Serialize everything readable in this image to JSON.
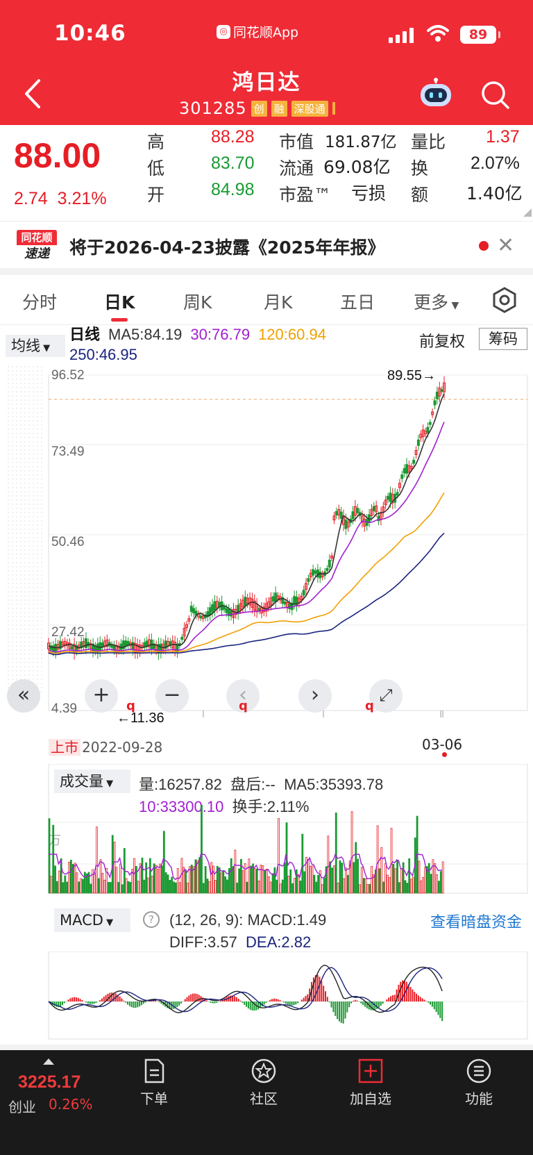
{
  "status": {
    "time": "10:46",
    "app": "同花顺App",
    "battery": "89"
  },
  "header": {
    "name": "鸿日达",
    "code": "301285",
    "tags": [
      "创",
      "融",
      "深股通"
    ]
  },
  "quote": {
    "price": "88.00",
    "change": "2.74",
    "pct": "3.21%",
    "high_label": "高",
    "high": "88.28",
    "low_label": "低",
    "low": "83.70",
    "open_label": "开",
    "open": "84.98",
    "mcap_label": "市值",
    "mcap": "181.87亿",
    "float_label": "流通",
    "float": "69.08亿",
    "pe_label": "市盈™",
    "pe": "亏损",
    "vr_label": "量比",
    "vr": "1.37",
    "turn_label": "换",
    "turn": "2.07%",
    "amt_label": "额",
    "amt": "1.40亿"
  },
  "notice": {
    "logo_top": "同花顺",
    "logo_bottom": "速递",
    "text": "将于2026-04-23披露《2025年年报》"
  },
  "tabs": [
    "分时",
    "日K",
    "周K",
    "月K",
    "五日",
    "更多"
  ],
  "ma": {
    "selector": "均线",
    "period": "日线",
    "ma5": "MA5:84.19",
    "ma30": "30:76.79",
    "ma120": "120:60.94",
    "ma250": "250:46.95",
    "adjust": "前复权",
    "chips": "筹码"
  },
  "kline": {
    "y_ticks": [
      "96.52",
      "73.49",
      "50.46",
      "27.42",
      "4.39"
    ],
    "max_label": "89.55→",
    "min_label": "←11.36",
    "listed_tag": "上市",
    "listed_date": "2022-09-28",
    "end_date": "03-06",
    "markers": [
      "q",
      "q",
      "q"
    ]
  },
  "volume": {
    "selector": "成交量",
    "vol": "量:16257.82",
    "after": "盘后:--",
    "ma5": "MA5:35393.78",
    "ma10": "10:33300.10",
    "turnover": "换手:2.11%",
    "unit": "万"
  },
  "macd": {
    "selector": "MACD",
    "params": "(12, 26, 9):",
    "macd": "MACD:1.49",
    "diff": "DIFF:3.57",
    "dea": "DEA:2.82",
    "link": "查看暗盘资金"
  },
  "bottom": {
    "index_value": "3225.17",
    "index_name": "创业",
    "index_pct": "0.26%",
    "nav": [
      "下单",
      "社区",
      "加自选",
      "功能"
    ]
  },
  "colors": {
    "brand": "#ef2b36",
    "up": "#e61e25",
    "down": "#1a9a32",
    "ma5": "#222222",
    "ma30": "#a020d0",
    "ma120": "#f0a000",
    "ma250": "#1a237e"
  }
}
